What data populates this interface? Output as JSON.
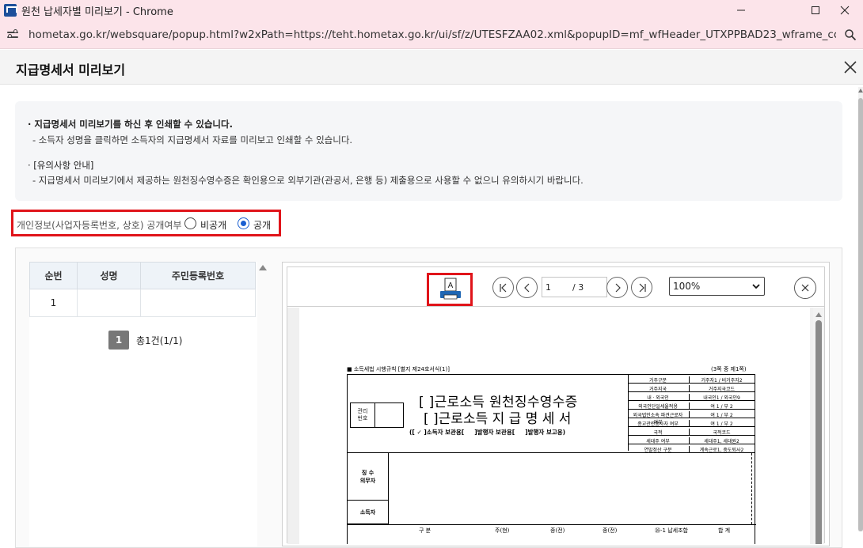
{
  "window": {
    "title": "원천 납세자별 미리보기 - Chrome",
    "url": "hometax.go.kr/websquare/popup.html?w2xPath=https://teht.hometax.go.kr/ui/sf/z/UTESFZAA02.xml&popupID=mf_wfHeader_UTXPPBAD23_wframe_contNon_..."
  },
  "popup": {
    "title": "지급명세서 미리보기"
  },
  "info": {
    "line1": "· 지급명세서 미리보기를 하신 후 인쇄할 수 있습니다.",
    "line2": "- 소득자 성명을 클릭하면 소득자의 지급명세서 자료를 미리보고 인쇄할 수 있습니다.",
    "line3": "· [유의사항 안내]",
    "line4": "- 지급명세서 미리보기에서 제공하는 원천징수영수증은 확인용으로 외부기관(관공서, 은행 등) 제출용으로 사용할 수 없으니 유의하시기 바랍니다."
  },
  "disclosure": {
    "label": "개인정보(사업자등록번호, 상호) 공개여부",
    "option_private": "비공개",
    "option_public": "공개",
    "selected": "공개"
  },
  "list": {
    "columns": [
      "순번",
      "성명",
      "주민등록번호"
    ],
    "rows": [
      [
        "1",
        "",
        ""
      ]
    ],
    "page_current": "1",
    "summary": "총1건(1/1)"
  },
  "viewer": {
    "print_label": "A",
    "page_current": "1",
    "page_total": "/ 3",
    "zoom": "100%"
  },
  "form": {
    "header_left": "■ 소득세법 시행규칙 [별지 제24호서식(1)]",
    "header_right": "(3쪽 중 제1쪽)",
    "mgmt_label": "관리\n번호",
    "title1": "[  ]근로소득 원천징수영수증",
    "title2": "[  ]근로소득 지 급 명 세 서",
    "subtitle": "([ ✓ ]소득자 보관용[     ]발행자 보관용[     ]발행자 보고용)",
    "right_rows": [
      [
        "거주구분",
        "거주자1 / 비거주자2"
      ],
      [
        "거주지국",
        "거주지국코드"
      ],
      [
        "내ㆍ외국인",
        "내국인1 / 외국인9"
      ],
      [
        "외국인단일세율적용",
        "여 1 / 부 2"
      ],
      [
        "외국법인소속 파견근로자 여부",
        "여 1 / 부 2"
      ],
      [
        "종교관련종사자 여부",
        "여 1 / 부 2"
      ],
      [
        "국적",
        "국적코드"
      ],
      [
        "세대주 여부",
        "세대주1, 세대원2"
      ],
      [
        "연말정산 구분",
        "계속근로1, 중도퇴사2"
      ]
    ],
    "section_withholder": "징 수\n의무자",
    "section_earner": "소득자",
    "bottom_headers": [
      "구 분",
      "주(현)",
      "종(전)",
      "종(전)",
      "㉖-1 납세조합",
      "합 계"
    ]
  }
}
